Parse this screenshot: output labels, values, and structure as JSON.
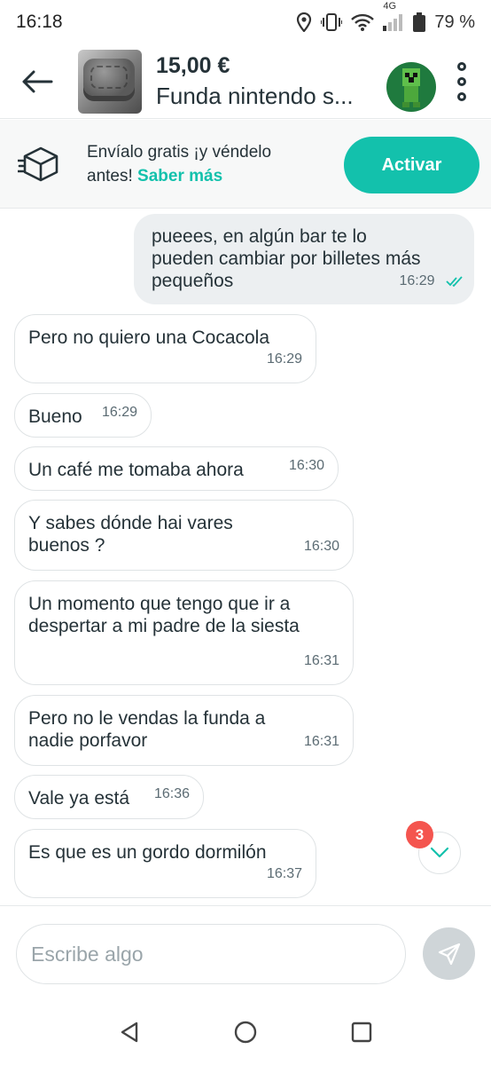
{
  "status": {
    "time": "16:18",
    "network": "4G",
    "battery": "79 %"
  },
  "header": {
    "price": "15,00 €",
    "product_title": "Funda nintendo s..."
  },
  "promo": {
    "text": "Envíalo gratis ¡y véndelo antes!",
    "link": "Saber más",
    "button": "Activar"
  },
  "messages": [
    {
      "direction": "out",
      "text": "pueees, en algún bar te lo\npueden cambiar por billetes más\npequeños",
      "time": "16:29",
      "read": true
    },
    {
      "direction": "in",
      "text": "Pero no quiero una Cocacola",
      "time": "16:29"
    },
    {
      "direction": "in",
      "text": "Bueno",
      "time": "16:29"
    },
    {
      "direction": "in",
      "text": "Un café me tomaba ahora",
      "time": "16:30"
    },
    {
      "direction": "in",
      "text": "Y sabes dónde hai vares\nbuenos ?",
      "time": "16:30"
    },
    {
      "direction": "in",
      "text": "Un momento que tengo que ir a\ndespertar a mi padre de la siesta",
      "time": "16:31"
    },
    {
      "direction": "in",
      "text": "Pero no le vendas la funda a\nnadie porfavor",
      "time": "16:31"
    },
    {
      "direction": "in",
      "text": "Vale ya está",
      "time": "16:36"
    },
    {
      "direction": "in",
      "text": "Es que es un gordo dormilón",
      "time": "16:37"
    }
  ],
  "unread_count": "3",
  "composer": {
    "placeholder": "Escribe algo"
  },
  "colors": {
    "accent": "#13c1ac",
    "badge": "#f4554f",
    "text": "#253238",
    "outgoing_bubble": "#eceff1"
  },
  "icons": [
    "location-icon",
    "vibrate-icon",
    "wifi-icon",
    "signal-icon",
    "battery-icon",
    "back-arrow-icon",
    "more-vert-icon",
    "box-shipping-icon",
    "chevron-down-icon",
    "send-icon",
    "nav-back-icon",
    "nav-home-icon",
    "nav-recents-icon",
    "double-check-icon"
  ]
}
